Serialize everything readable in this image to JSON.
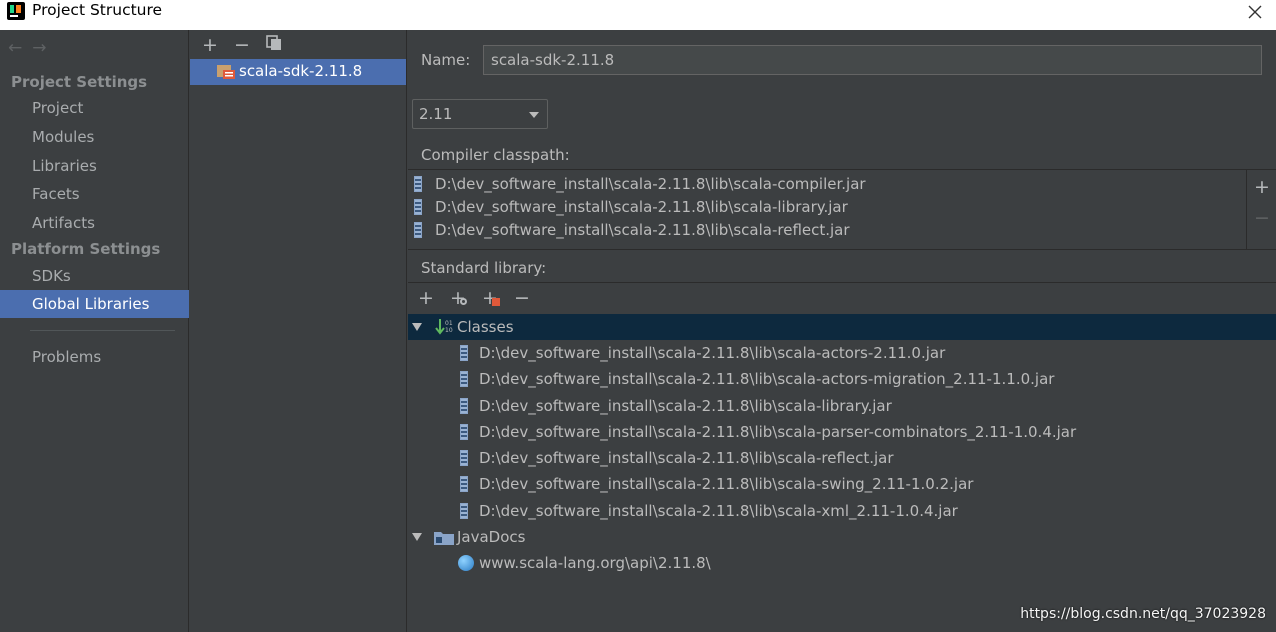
{
  "window": {
    "title": "Project Structure"
  },
  "nav": {
    "back_icon": "arrow-left-icon",
    "forward_icon": "arrow-right-icon",
    "project_settings_heading": "Project Settings",
    "platform_settings_heading": "Platform Settings",
    "items": [
      {
        "label": "Project"
      },
      {
        "label": "Modules"
      },
      {
        "label": "Libraries"
      },
      {
        "label": "Facets"
      },
      {
        "label": "Artifacts"
      },
      {
        "label": "SDKs"
      },
      {
        "label": "Global Libraries",
        "selected": true
      },
      {
        "label": "Problems"
      }
    ]
  },
  "library_list": {
    "tools": {
      "add": "+",
      "remove": "−",
      "copy_icon": "copy-icon"
    },
    "items": [
      {
        "label": "scala-sdk-2.11.8",
        "selected": true
      }
    ]
  },
  "detail": {
    "name_label": "Name:",
    "name_value": "scala-sdk-2.11.8",
    "version_selected": "2.11",
    "compiler_classpath_label": "Compiler classpath:",
    "compiler_classpath": [
      "D:\\dev_software_install\\scala-2.11.8\\lib\\scala-compiler.jar",
      "D:\\dev_software_install\\scala-2.11.8\\lib\\scala-library.jar",
      "D:\\dev_software_install\\scala-2.11.8\\lib\\scala-reflect.jar"
    ],
    "classpath_tools": {
      "add": "+",
      "remove": "−"
    },
    "standard_library_label": "Standard library:",
    "std_tools": {
      "add": "+",
      "add_with_config": "+",
      "add_jar": "+",
      "remove": "−"
    },
    "classes_label": "Classes",
    "classes": [
      "D:\\dev_software_install\\scala-2.11.8\\lib\\scala-actors-2.11.0.jar",
      "D:\\dev_software_install\\scala-2.11.8\\lib\\scala-actors-migration_2.11-1.1.0.jar",
      "D:\\dev_software_install\\scala-2.11.8\\lib\\scala-library.jar",
      "D:\\dev_software_install\\scala-2.11.8\\lib\\scala-parser-combinators_2.11-1.0.4.jar",
      "D:\\dev_software_install\\scala-2.11.8\\lib\\scala-reflect.jar",
      "D:\\dev_software_install\\scala-2.11.8\\lib\\scala-swing_2.11-1.0.2.jar",
      "D:\\dev_software_install\\scala-2.11.8\\lib\\scala-xml_2.11-1.0.4.jar"
    ],
    "javadocs_label": "JavaDocs",
    "javadocs": [
      "www.scala-lang.org\\api\\2.11.8\\"
    ]
  },
  "watermark": "https://blog.csdn.net/qq_37023928",
  "colors": {
    "selection": "#4b6eaf",
    "tree_selection": "#0d293e",
    "background": "#3c3f41"
  }
}
